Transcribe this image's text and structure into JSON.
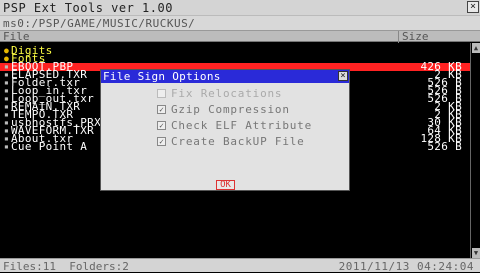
{
  "window": {
    "title": "PSP Ext Tools ver 1.00",
    "close_glyph": "×"
  },
  "path": "ms0:/PSP/GAME/MUSIC/RUCKUS/",
  "columns": {
    "file": "File",
    "size": "Size"
  },
  "files": [
    {
      "name": "Digits",
      "size": "",
      "type": "folder"
    },
    {
      "name": "Fonts",
      "size": "",
      "type": "folder"
    },
    {
      "name": "EBOOT.PBP",
      "size": "426 KB",
      "type": "file",
      "selected": true
    },
    {
      "name": "ELAPSED.TXR",
      "size": "2 KB",
      "type": "file"
    },
    {
      "name": "Folder.txr",
      "size": "526 B",
      "type": "file"
    },
    {
      "name": "Loop_in.txr",
      "size": "526 B",
      "type": "file"
    },
    {
      "name": "Loop_out.txr",
      "size": "526 B",
      "type": "file"
    },
    {
      "name": "REMAIN.TXR",
      "size": "2 KB",
      "type": "file"
    },
    {
      "name": "TEMPO.TXR",
      "size": "2 KB",
      "type": "file"
    },
    {
      "name": "usbhostfs.PRX",
      "size": "30 KB",
      "type": "file"
    },
    {
      "name": "WAVEFORM.TXR",
      "size": "64 KB",
      "type": "file"
    },
    {
      "name": "About.txr",
      "size": "128 KB",
      "type": "file"
    },
    {
      "name": "Cue Point A",
      "size": "526 B",
      "type": "file"
    }
  ],
  "dialog": {
    "title": "File Sign Options",
    "options": [
      {
        "label": "Fix Relocations",
        "checked": false,
        "enabled": false
      },
      {
        "label": "Gzip Compression",
        "checked": true,
        "enabled": true
      },
      {
        "label": "Check ELF Attribute",
        "checked": true,
        "enabled": true
      },
      {
        "label": "Create BackUP File",
        "checked": true,
        "enabled": true
      }
    ],
    "ok_label": "OK"
  },
  "status": {
    "files": "Files:11",
    "folders": "Folders:2",
    "datetime": "2011/11/13  04:24:04"
  },
  "colors": {
    "selection": "#ff2222",
    "dialog_title": "#2a2ad8",
    "folder_text": "#ffff44"
  }
}
